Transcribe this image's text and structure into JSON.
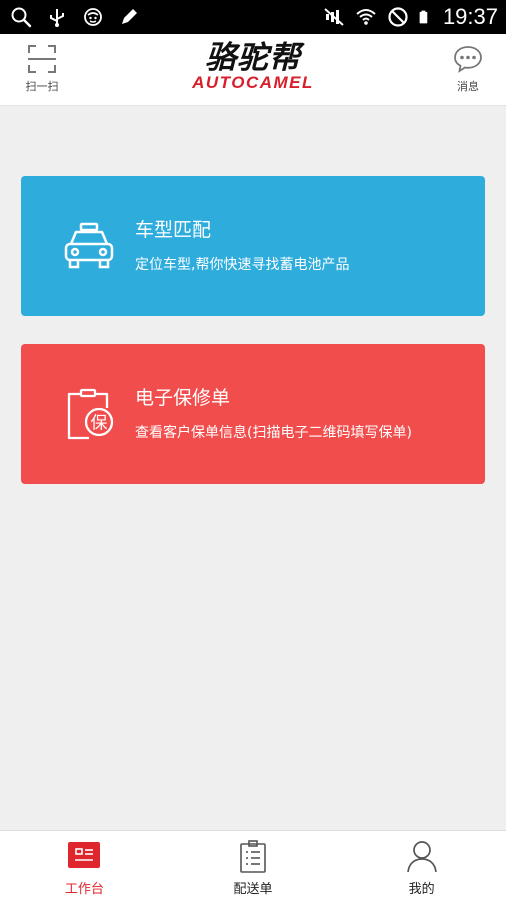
{
  "status_bar": {
    "time": "19:37",
    "left_icons": [
      "search-icon",
      "usb-icon",
      "app-icon",
      "pencil-icon"
    ],
    "right_icons": [
      "mute-icon",
      "wifi-icon",
      "do-not-disturb-icon",
      "battery-icon"
    ]
  },
  "header": {
    "scan_label": "扫一扫",
    "message_label": "消息",
    "logo_cn": "骆驼帮",
    "logo_en": "AUTOCAMEL"
  },
  "cards": [
    {
      "title": "车型匹配",
      "description": "定位车型,帮你快速寻找蓄电池产品",
      "icon": "car-icon",
      "color": "#2eacdc"
    },
    {
      "title": "电子保修单",
      "description": "查看客户保单信息(扫描电子二维码填写保单)",
      "icon": "warranty-clipboard-icon",
      "icon_text": "保",
      "color": "#f24d4d"
    }
  ],
  "bottom_nav": [
    {
      "label": "工作台",
      "icon": "workbench-icon",
      "active": true
    },
    {
      "label": "配送单",
      "icon": "clipboard-icon",
      "active": false
    },
    {
      "label": "我的",
      "icon": "user-icon",
      "active": false
    }
  ],
  "colors": {
    "accent_red": "#e0262d",
    "card_blue": "#2eacdc",
    "card_red": "#f24d4d",
    "background": "#efefef"
  }
}
